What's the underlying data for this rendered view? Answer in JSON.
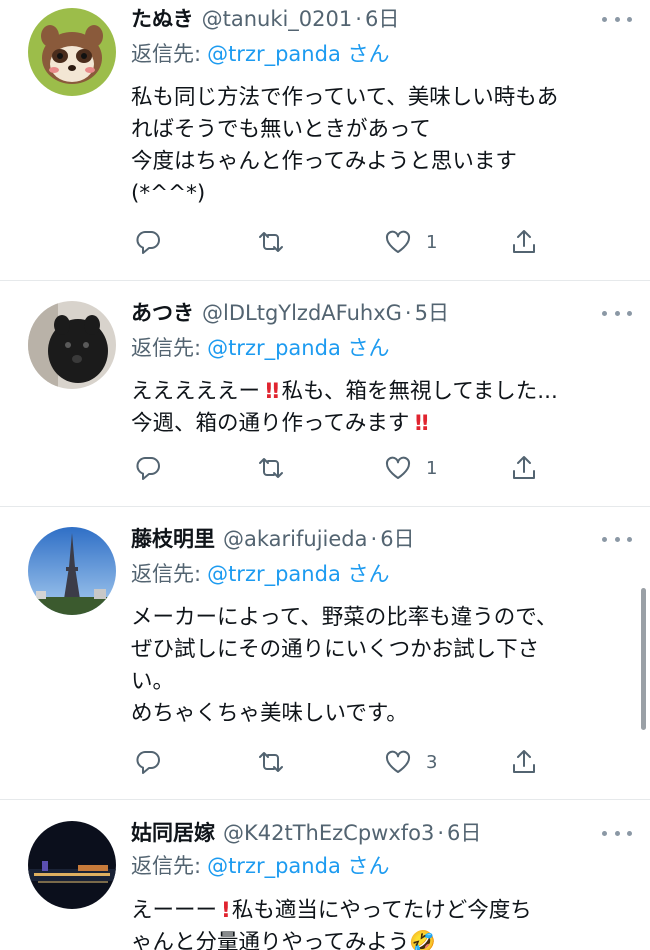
{
  "tweets": [
    {
      "name": "たぬき",
      "handle": "@tanuki_0201",
      "dot": "·",
      "time": "6日",
      "reply_label": "返信先:",
      "reply_user": "@trzr_panda さん",
      "lines": [
        "私も同じ方法で作っていて、美味しい時もあ",
        "ればそうでも無いときがあって",
        "今度はちゃんと作ってみようと思います",
        "(*^^*)"
      ],
      "like_count": "1"
    },
    {
      "name": "あつき",
      "handle": "@lDLtgYlzdAFuhxG",
      "dot": "·",
      "time": "5日",
      "reply_label": "返信先:",
      "reply_user": "@trzr_panda さん",
      "line1_a": "えええええー",
      "bang": "!!",
      "line1_b": "私も、箱を無視してました...",
      "line2": "今週、箱の通り作ってみます",
      "like_count": "1"
    },
    {
      "name": "藤枝明里",
      "handle": "@akarifujieda",
      "dot": "·",
      "time": "6日",
      "reply_label": "返信先:",
      "reply_user": "@trzr_panda さん",
      "lines": [
        "メーカーによって、野菜の比率も違うので、",
        "ぜひ試しにその通りにいくつかお試し下さ",
        "い。",
        "めちゃくちゃ美味しいです。"
      ],
      "like_count": "3"
    },
    {
      "name": "姑同居嫁",
      "handle": "@K42tThEzCpwxfo3",
      "dot": "·",
      "time": "6日",
      "reply_label": "返信先:",
      "reply_user": "@trzr_panda さん",
      "line1_a": "えーーー",
      "bang": "!",
      "line1_b": "私も適当にやってたけど今度ち",
      "line2": "ゃんと分量通りやってみよう🤣"
    }
  ],
  "icons": {
    "reply": "reply-icon",
    "retweet": "retweet-icon",
    "like": "heart-icon",
    "share": "share-icon",
    "more": "more-icon"
  },
  "colors": {
    "link": "#1d9bf0",
    "secondary_text": "#536471",
    "emphasis_red": "#e0242f"
  }
}
